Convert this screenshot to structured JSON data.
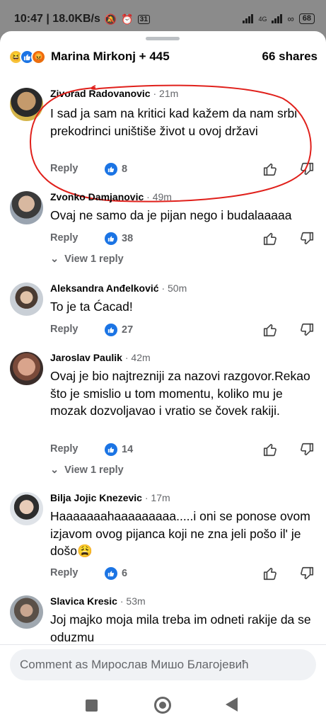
{
  "status_bar": {
    "time_speed": "10:47 | 18.0KB/s",
    "calendar_day": "31",
    "network": "4G",
    "battery": "68"
  },
  "post": {
    "reactors": "Marina Mirkonj + 445",
    "shares": "66 shares"
  },
  "comments": [
    {
      "author": "Zivorad Radovanovic",
      "time": "21m",
      "text": "I sad ja sam na kritici kad kažem da nam srbi prekodrinci uništiše život u ovoj državi",
      "reply_label": "Reply",
      "likes": "8"
    },
    {
      "author": "Zvonko Damjanovic",
      "time": "49m",
      "text": "Ovaj ne samo da je pijan nego i budalaaaaa",
      "reply_label": "Reply",
      "likes": "38",
      "view_replies": "View 1 reply"
    },
    {
      "author": "Aleksandra Anđelković",
      "time": "50m",
      "text": "To je ta Ćacad!",
      "reply_label": "Reply",
      "likes": "27"
    },
    {
      "author": "Jaroslav Paulik",
      "time": "42m",
      "text": "Ovaj je bio najtrezniji za nazovi razgovor.Rekao što je smislio u tom momentu, koliko mu je mozak dozvoljavao i vratio se čovek rakiji.",
      "reply_label": "Reply",
      "likes": "14",
      "view_replies": "View 1 reply"
    },
    {
      "author": "Bilja Jojic Knezevic",
      "time": "17m",
      "text": "Haaaaaaahaaaaaaaaa.....i oni se ponose ovom izjavom ovog pijanca koji ne zna jeli pošo il' je došo😩",
      "reply_label": "Reply",
      "likes": "6"
    },
    {
      "author": "Slavica Kresic",
      "time": "53m",
      "text": "Joj majko moja mila treba im odneti rakije da se oduzmu"
    }
  ],
  "composer": {
    "placeholder": "Comment as Мирослав Мишо Благојевић"
  },
  "colors": {
    "accent": "#1b74e4",
    "annotation": "#e0201b",
    "secondary_text": "#65676b"
  }
}
